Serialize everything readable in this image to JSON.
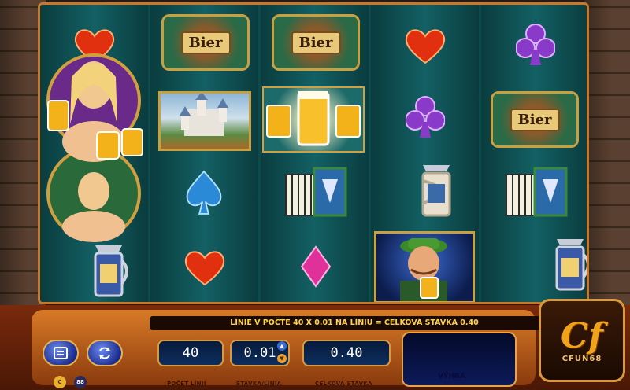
{
  "info_line": "LÍNIE V POČTE 40 X 0.01 NA LÍNIU = CELKOVÁ STÁVKA 0.40",
  "lines": {
    "value": "40",
    "label": "POČET LÍNIÍ"
  },
  "bet_per_line": {
    "value": "0.01",
    "label": "STÁVKA/LÍNIA"
  },
  "total_bet": {
    "value": "0.40",
    "label": "CELKOVÁ STÁVKA"
  },
  "win": {
    "label": "VÝHRA"
  },
  "logo": {
    "main": "Cf",
    "sub": "CFUN68"
  },
  "reel_sign": "Bier",
  "small_buttons": [
    "C",
    "88"
  ],
  "icons": {
    "paytable": "paytable-icon",
    "autoplay": "autoplay-icon",
    "bet_up": "arrow-up-icon",
    "bet_down": "arrow-down-icon"
  },
  "colors": {
    "accent": "#d87a26",
    "info_text": "#ffd24a",
    "reels_bg": "#0c4a4c"
  }
}
